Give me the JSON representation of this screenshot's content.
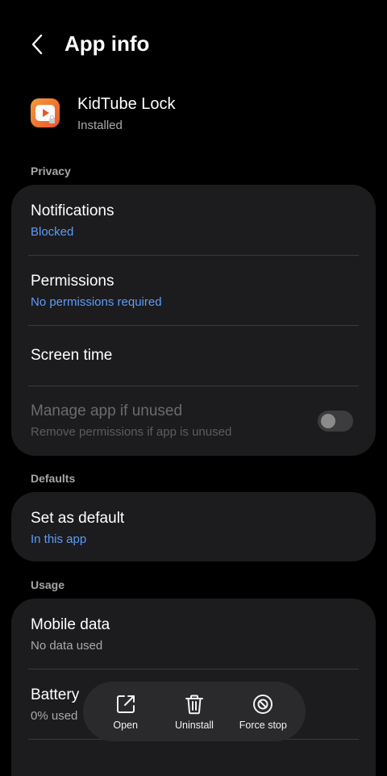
{
  "header": {
    "title": "App info",
    "back_icon": "chevron-left-icon"
  },
  "app": {
    "name": "KidTube Lock",
    "status": "Installed",
    "icon": "play-lock-icon",
    "icon_colors": [
      "#f59a3a",
      "#e9562b"
    ]
  },
  "sections": {
    "privacy": "Privacy",
    "defaults": "Defaults",
    "usage": "Usage"
  },
  "privacy": {
    "notifications": {
      "label": "Notifications",
      "value": "Blocked"
    },
    "permissions": {
      "label": "Permissions",
      "value": "No permissions required"
    },
    "screen_time": {
      "label": "Screen time"
    },
    "manage_unused": {
      "label": "Manage app if unused",
      "desc": "Remove permissions if app is unused",
      "enabled": false
    }
  },
  "defaults": {
    "set_default": {
      "label": "Set as default",
      "value": "In this app"
    }
  },
  "usage": {
    "mobile_data": {
      "label": "Mobile data",
      "value": "No data used"
    },
    "battery": {
      "label": "Battery",
      "value": "0% used"
    }
  },
  "actions": {
    "open": {
      "label": "Open",
      "icon": "open-external-icon"
    },
    "uninstall": {
      "label": "Uninstall",
      "icon": "trash-icon"
    },
    "force_stop": {
      "label": "Force stop",
      "icon": "stop-circle-icon"
    }
  },
  "colors": {
    "background": "#000000",
    "card": "#1c1c1e",
    "accent": "#5d9cf5",
    "secondary_text": "#a9a9a9"
  }
}
